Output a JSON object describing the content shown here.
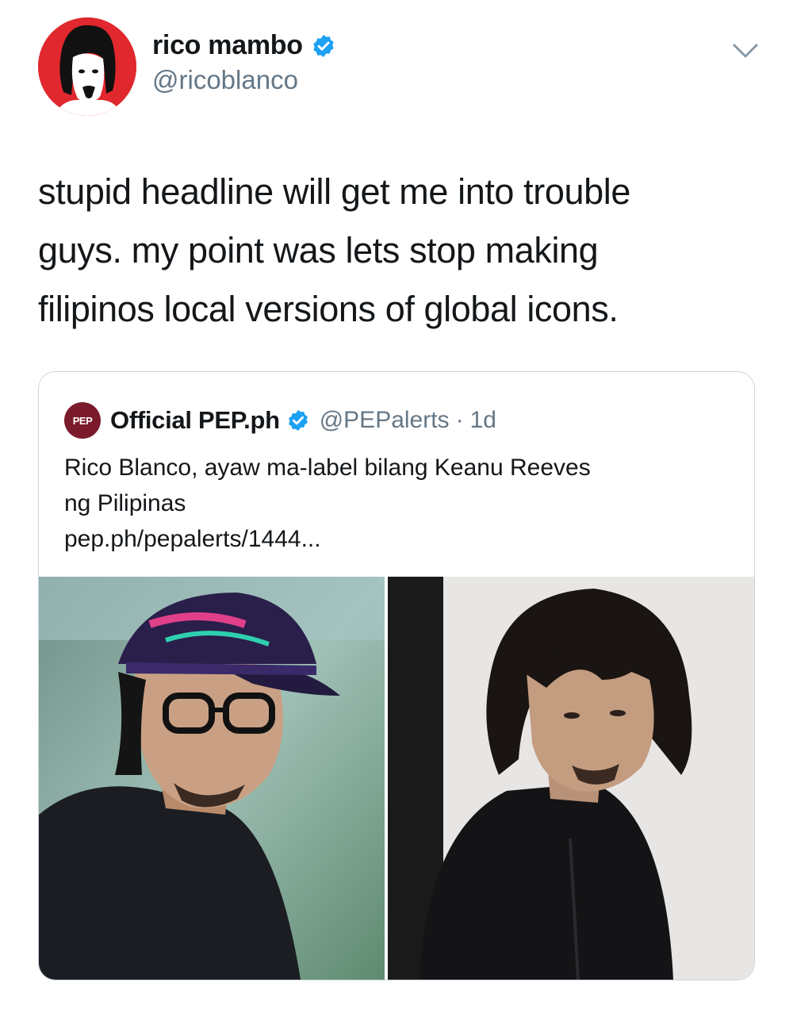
{
  "tweet": {
    "author": {
      "display_name": "rico mambo",
      "handle": "@ricoblanco",
      "verified": true,
      "avatar_icon": "caricature-avatar-icon",
      "avatar_color": "#e0282e"
    },
    "text_lines": [
      "stupid headline will get me into trouble",
      "guys. my point was lets stop making",
      "filipinos local versions of global icons."
    ],
    "menu_icon": "chevron-down-icon"
  },
  "quoted_tweet": {
    "author": {
      "logo_text": "PEP",
      "display_name": "Official PEP.ph",
      "handle": "@PEPalerts",
      "verified": true
    },
    "separator": "·",
    "time": "1d",
    "text_lines": [
      "Rico Blanco, ayaw ma-label bilang Keanu Reeves",
      "ng Pilipinas"
    ],
    "link": "pep.ph/pepalerts/1444...",
    "media": [
      {
        "name": "photo-man-in-cap"
      },
      {
        "name": "photo-man-long-hair"
      }
    ]
  },
  "colors": {
    "verified": "#1da1f2",
    "secondary_text": "#657786",
    "primary_text": "#14171a",
    "pep_logo": "#7a1a2a"
  }
}
